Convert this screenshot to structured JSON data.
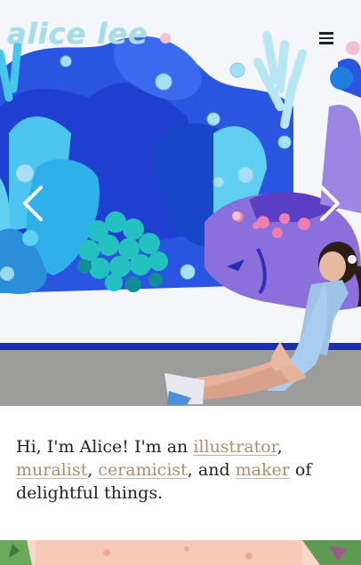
{
  "header": {
    "logo_text": "alice lee",
    "menu_icon": "hamburger-menu-icon"
  },
  "hero": {
    "description": "hero-photo",
    "prev_icon": "chevron-left-icon",
    "next_icon": "chevron-right-icon"
  },
  "intro": {
    "prefix": "Hi, I'm Alice! I'm an ",
    "link_1": "illustrator",
    "sep_1": ", ",
    "link_2": "muralist",
    "sep_2": ", ",
    "link_3": "ceramicist",
    "sep_3": ", and ",
    "link_4": "maker",
    "suffix": " of delightful things."
  },
  "colors": {
    "link": "#b08d6b",
    "logo": "#a9dce9",
    "text": "#222222"
  }
}
